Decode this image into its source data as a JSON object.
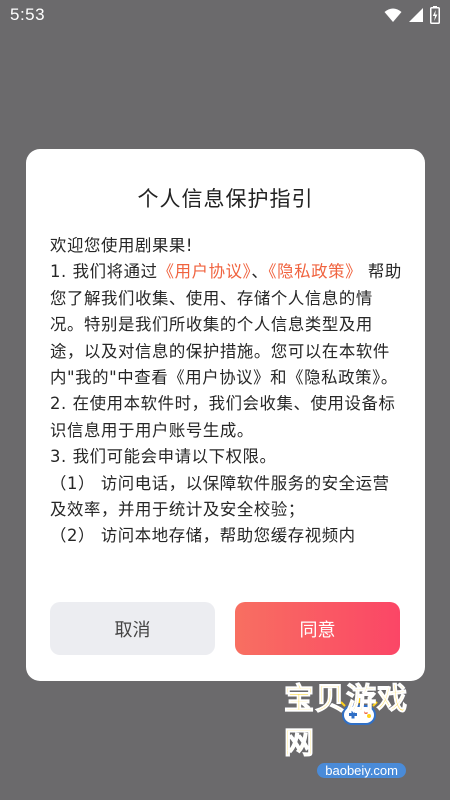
{
  "status_bar": {
    "time": "5:53",
    "icons": [
      "wifi-icon",
      "cell-signal-icon",
      "battery-icon"
    ]
  },
  "dialog": {
    "title": "个人信息保护指引",
    "body": {
      "greeting": "欢迎您使用剧果果!",
      "item1_prefix": "1. 我们将通过",
      "user_agreement_link": "《用户协议》",
      "separator": "、",
      "privacy_policy_link": "《隐私政策》",
      "item1_suffix": " 帮助您了解我们收集、使用、存储个人信息的情况。特别是我们所收集的个人信息类型及用途，以及对信息的保护措施。您可以在本软件内\"我的\"中查看《用户协议》和《隐私政策》。",
      "item2": "2. 在使用本软件时，我们会收集、使用设备标识信息用于用户账号生成。",
      "item3": "3. 我们可能会申请以下权限。",
      "perm1": "（1） 访问电话，以保障软件服务的安全运营及效率，并用于统计及安全校验；",
      "perm2": "（2） 访问本地存储，帮助您缓存视频内"
    },
    "buttons": {
      "cancel": "取消",
      "agree": "同意"
    }
  },
  "watermark": {
    "brand": "宝贝游戏网",
    "domain": "baobeiy.com"
  },
  "colors": {
    "link": "#f0633f",
    "agree_gradient_start": "#f86f61",
    "agree_gradient_end": "#fb4666",
    "cancel_bg": "#ecedf1",
    "overlay": "#6b6a6c"
  }
}
